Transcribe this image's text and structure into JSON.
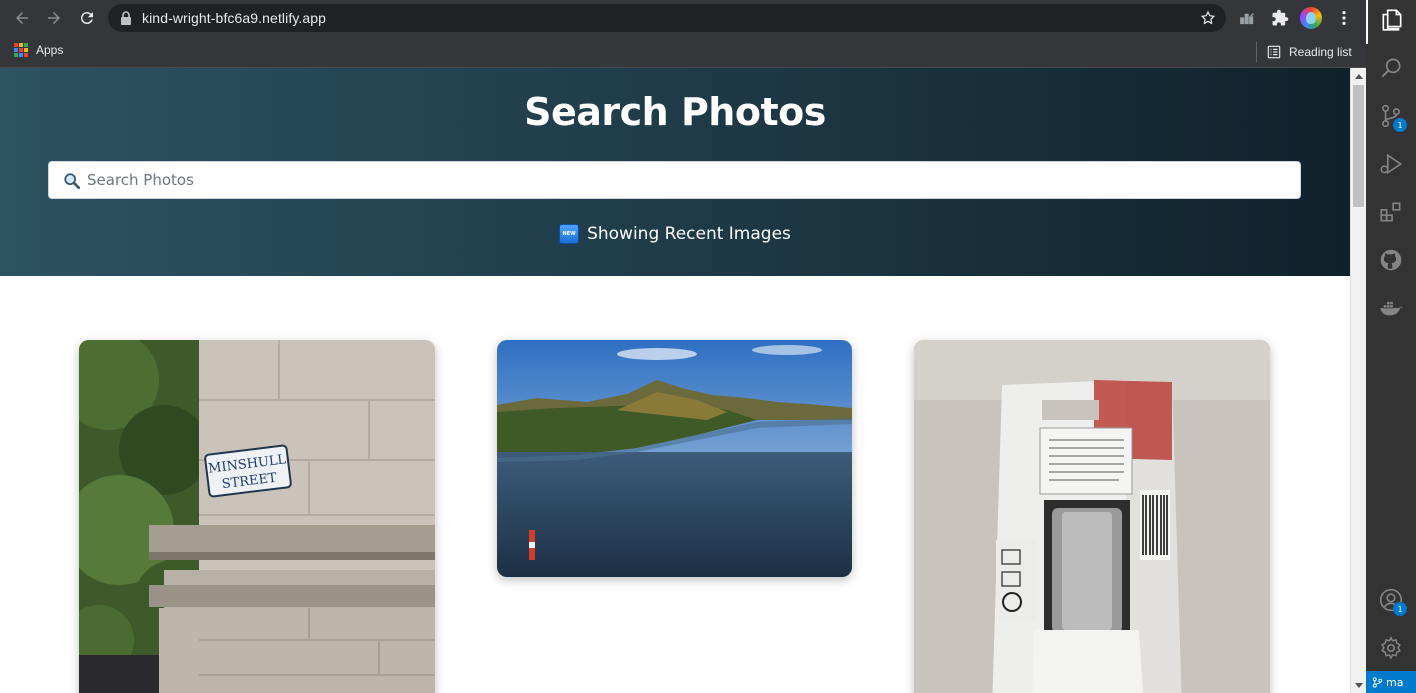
{
  "browser": {
    "url": "kind-wright-bfc6a9.netlify.app",
    "icons": {
      "back": "back-arrow-icon",
      "forward": "forward-arrow-icon",
      "reload": "reload-icon",
      "lock": "lock-icon",
      "bookmark": "star-icon",
      "extensions": "puzzle-icon"
    },
    "bookmarks": {
      "apps_label": "Apps",
      "reading_list_label": "Reading list"
    }
  },
  "page": {
    "title": "Search Photos",
    "search": {
      "placeholder": "Search Photos",
      "value": ""
    },
    "status": {
      "badge": "NEW",
      "text": "Showing Recent Images"
    },
    "photos": [
      {
        "sign_line1": "MINSHULL",
        "sign_line2": "STREET"
      },
      {
        "subject": "lake-landscape"
      },
      {
        "subject": "touch-up-paint-package"
      }
    ],
    "colors": {
      "hero_start": "#2d5262",
      "hero_end": "#10212b",
      "accent": "#007acc"
    }
  },
  "vscode": {
    "activity": [
      {
        "name": "explorer-icon"
      },
      {
        "name": "search-icon"
      },
      {
        "name": "source-control-icon",
        "badge": "1"
      },
      {
        "name": "run-debug-icon"
      },
      {
        "name": "extensions-icon"
      },
      {
        "name": "github-icon"
      },
      {
        "name": "docker-icon"
      },
      {
        "name": "account-icon",
        "badge": "1"
      },
      {
        "name": "settings-gear-icon"
      }
    ],
    "statusbar_branch": "ma"
  }
}
